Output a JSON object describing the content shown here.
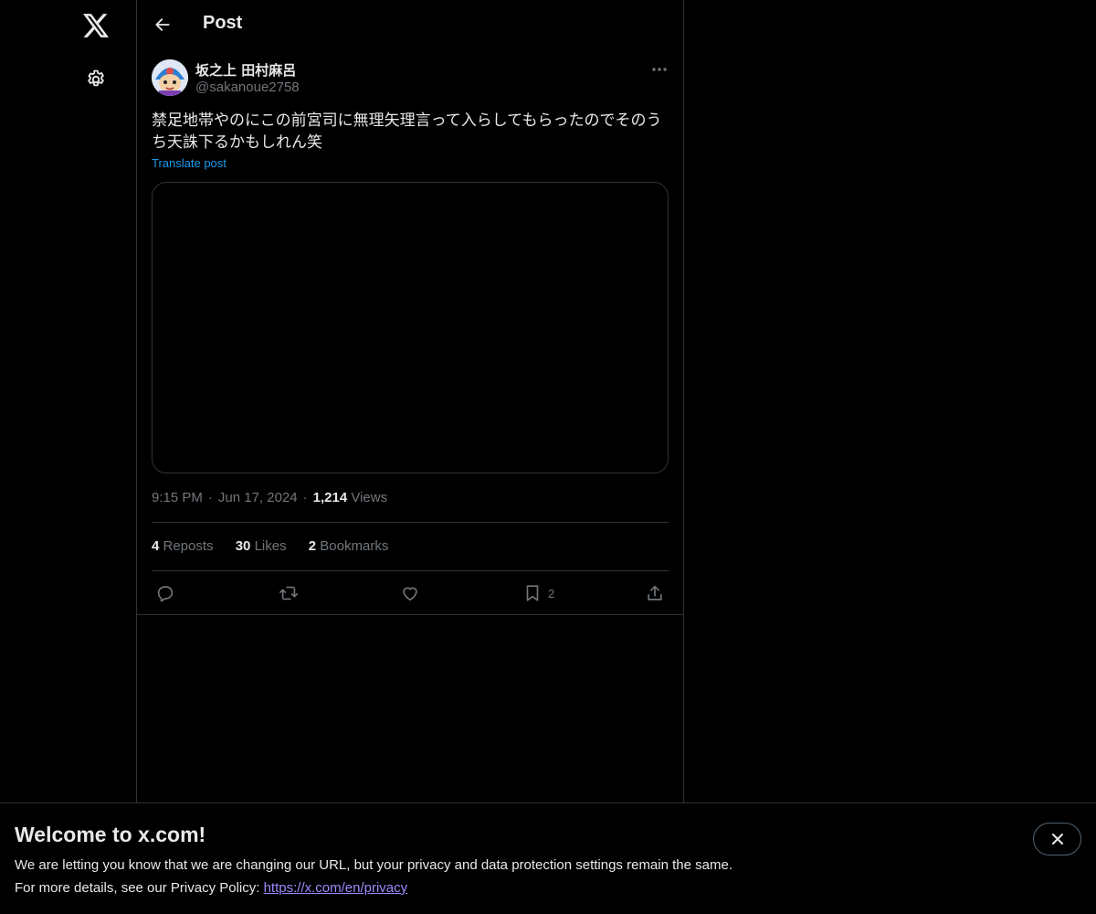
{
  "nav": {
    "logo_icon": "x-logo-icon",
    "settings_icon": "gear-icon"
  },
  "header": {
    "title": "Post",
    "back_icon": "arrow-left-icon"
  },
  "post": {
    "author_name": "坂之上 田村麻呂",
    "author_handle": "@sakanoue2758",
    "text": "禁足地帯やのにこの前宮司に無理矢理言って入らしてもらったのでそのうち天誅下るかもしれん笑",
    "translate_label": "Translate post",
    "time": "9:15 PM",
    "date": "Jun 17, 2024",
    "views_count": "1,214",
    "views_label": "Views",
    "stats": {
      "reposts_count": "4",
      "reposts_label": "Reposts",
      "likes_count": "30",
      "likes_label": "Likes",
      "bookmarks_count": "2",
      "bookmarks_label": "Bookmarks"
    },
    "actions": {
      "reply_icon": "reply-icon",
      "repost_icon": "repost-icon",
      "like_icon": "heart-icon",
      "bookmark_icon": "bookmark-icon",
      "bookmark_count": "2",
      "share_icon": "share-icon"
    }
  },
  "banner": {
    "title": "Welcome to x.com!",
    "line1": "We are letting you know that we are changing our URL, but your privacy and data protection settings remain the same.",
    "line2_prefix": "For more details, see our Privacy Policy: ",
    "link_text": "https://x.com/en/privacy",
    "close_icon": "close-icon"
  },
  "colors": {
    "background": "#000000",
    "text_primary": "#e7e9ea",
    "text_secondary": "#71767b",
    "accent": "#1d9bf0",
    "border": "#2f3336",
    "link": "#9d8cff"
  }
}
